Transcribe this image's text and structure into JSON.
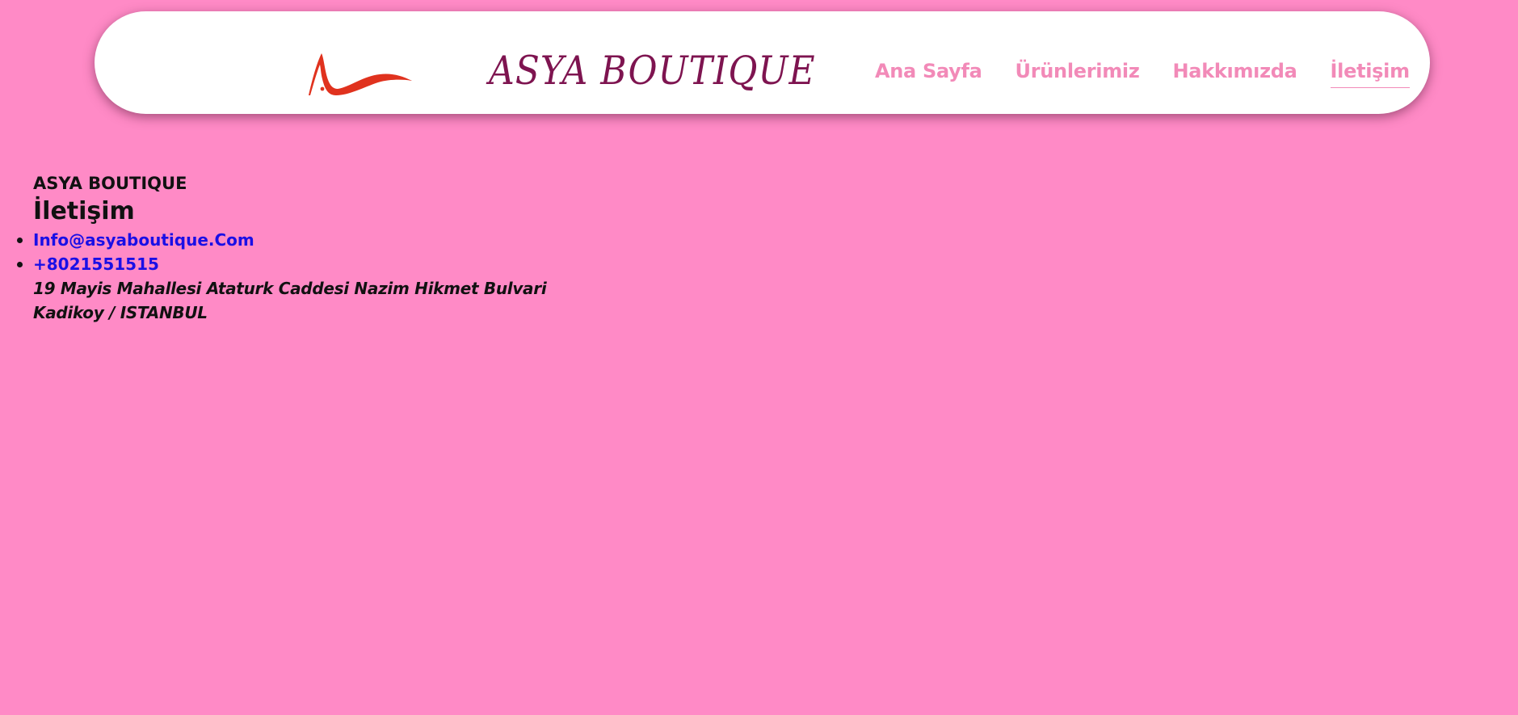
{
  "header": {
    "logo_icon": "asya-swoosh-logo",
    "brand": "ASYA BOUTIQUE",
    "nav": [
      {
        "label": "Ana Sayfa",
        "active": false
      },
      {
        "label": "Ürünlerimiz",
        "active": false
      },
      {
        "label": "Hakkımızda",
        "active": false
      },
      {
        "label": "İletişim",
        "active": true
      }
    ]
  },
  "contact": {
    "site_name": "ASYA BOUTIQUE",
    "heading": "İletişim",
    "email": "Info@asyaboutique.Com",
    "phone": "+8021551515",
    "address_line1": "19 Mayis Mahallesi Ataturk Caddesi Nazim Hikmet Bulvari",
    "address_line2": "Kadikoy / ISTANBUL"
  },
  "colors": {
    "page_background": "#ff8ac6",
    "header_background": "#ffffff",
    "brand_text": "#7e1450",
    "nav_text": "#f28ab8",
    "link_text": "#1a0fe6",
    "logo_red": "#e0321e"
  }
}
